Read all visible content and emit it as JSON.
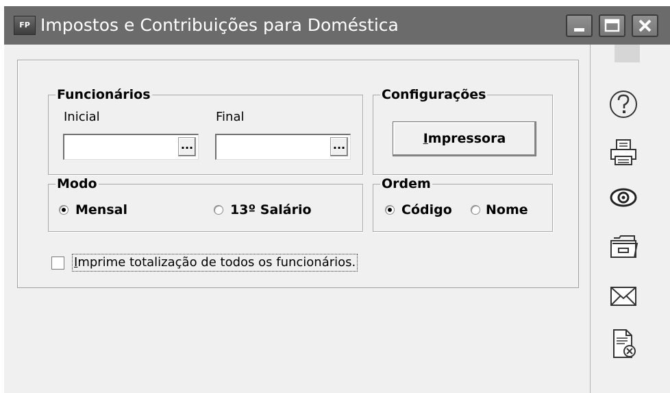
{
  "window": {
    "app_icon_text": "FP",
    "title": "Impostos e Contribuições para Doméstica",
    "controls": [
      "minimize",
      "maximize",
      "close"
    ]
  },
  "funcionarios": {
    "legend": "Funcionários",
    "inicial_label": "Inicial",
    "final_label": "Final",
    "inicial_value": "",
    "final_value": "",
    "lookup_button": "..."
  },
  "configuracoes": {
    "legend": "Configurações",
    "impressora_button": "Impressora",
    "impressora_mnemonic": "I",
    "impressora_rest": "mpressora"
  },
  "modo": {
    "legend": "Modo",
    "options": [
      "Mensal",
      "13º Salário"
    ],
    "selected": "Mensal"
  },
  "ordem": {
    "legend": "Ordem",
    "options": [
      "Código",
      "Nome"
    ],
    "selected": "Código"
  },
  "totalizacao": {
    "label": "Imprime totalização de todos os funcionários.",
    "mnemonic": "I",
    "label_rest": "mprime totalização de todos os funcionários.",
    "checked": false
  },
  "sidebar": {
    "icons": [
      "help-icon",
      "printer-icon",
      "preview-icon",
      "folder-icon",
      "email-icon",
      "document-close-icon"
    ]
  },
  "colors": {
    "titlebar": "#6b6b6b",
    "panel_bg": "#f0f0f0",
    "border": "#a0a0a0"
  }
}
